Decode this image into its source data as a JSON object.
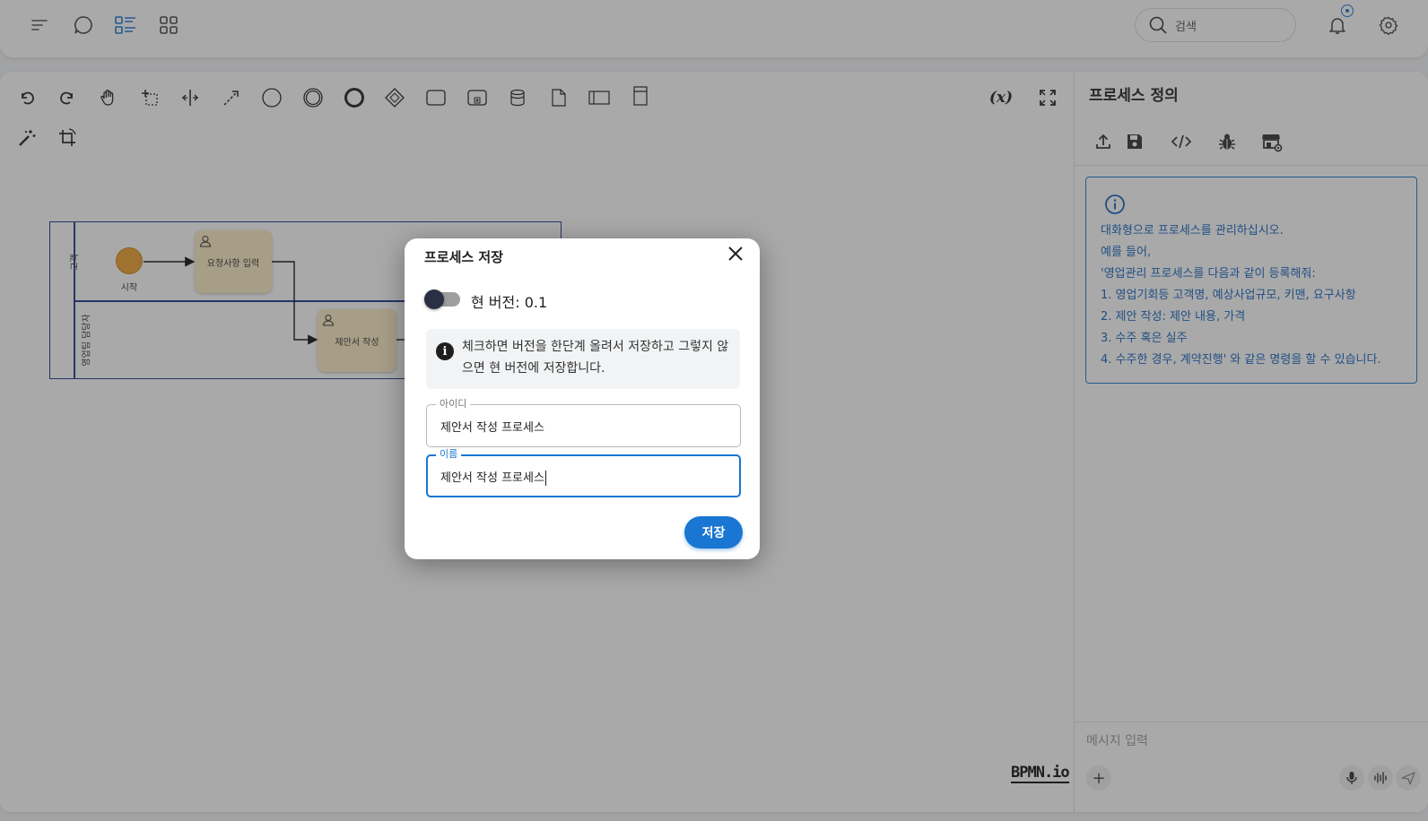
{
  "topbar": {
    "search_placeholder": "검색"
  },
  "pool": {
    "lane1_label": "고객",
    "lane2_label": "영업팀 담당자",
    "start_label": "시작",
    "task1_label": "요청사항 입력",
    "task2_label": "제안서 작성"
  },
  "canvas": {
    "variables_label": "(x)",
    "watermark": "BPMN.io"
  },
  "panel": {
    "title": "프로세스 정의",
    "info_lines": [
      "대화형으로 프로세스를 관리하십시오.",
      "예를 들어,",
      "'영업관리 프로세스를 다음과 같이 등록해줘:",
      "1. 영업기회등 고객명, 예상사업규모, 키맨, 요구사항",
      "2. 제안 작성: 제안 내용, 가격",
      "3. 수주 혹은 실주",
      "4. 수주한 경우, 계약진행' 와 같은 명령을 할 수 있습니다."
    ],
    "message_placeholder": "메시지 입력",
    "add_label": "+"
  },
  "dialog": {
    "title": "프로세스 저장",
    "toggle_label": "현 버전: 0.1",
    "toggle_on": false,
    "alert_text": "체크하면 버전을 한단계 올려서 저장하고 그렇지 않으면 현 버전에 저장합니다.",
    "id_label": "아이디",
    "id_value": "제안서 작성 프로세스",
    "name_label": "이름",
    "name_value": "제안서 작성 프로세스",
    "save_label": "저장"
  },
  "colors": {
    "accent": "#1976d2",
    "task_fill": "#fbecc4",
    "start_event": "#f0a030",
    "pool_border": "#1a3a8f"
  }
}
